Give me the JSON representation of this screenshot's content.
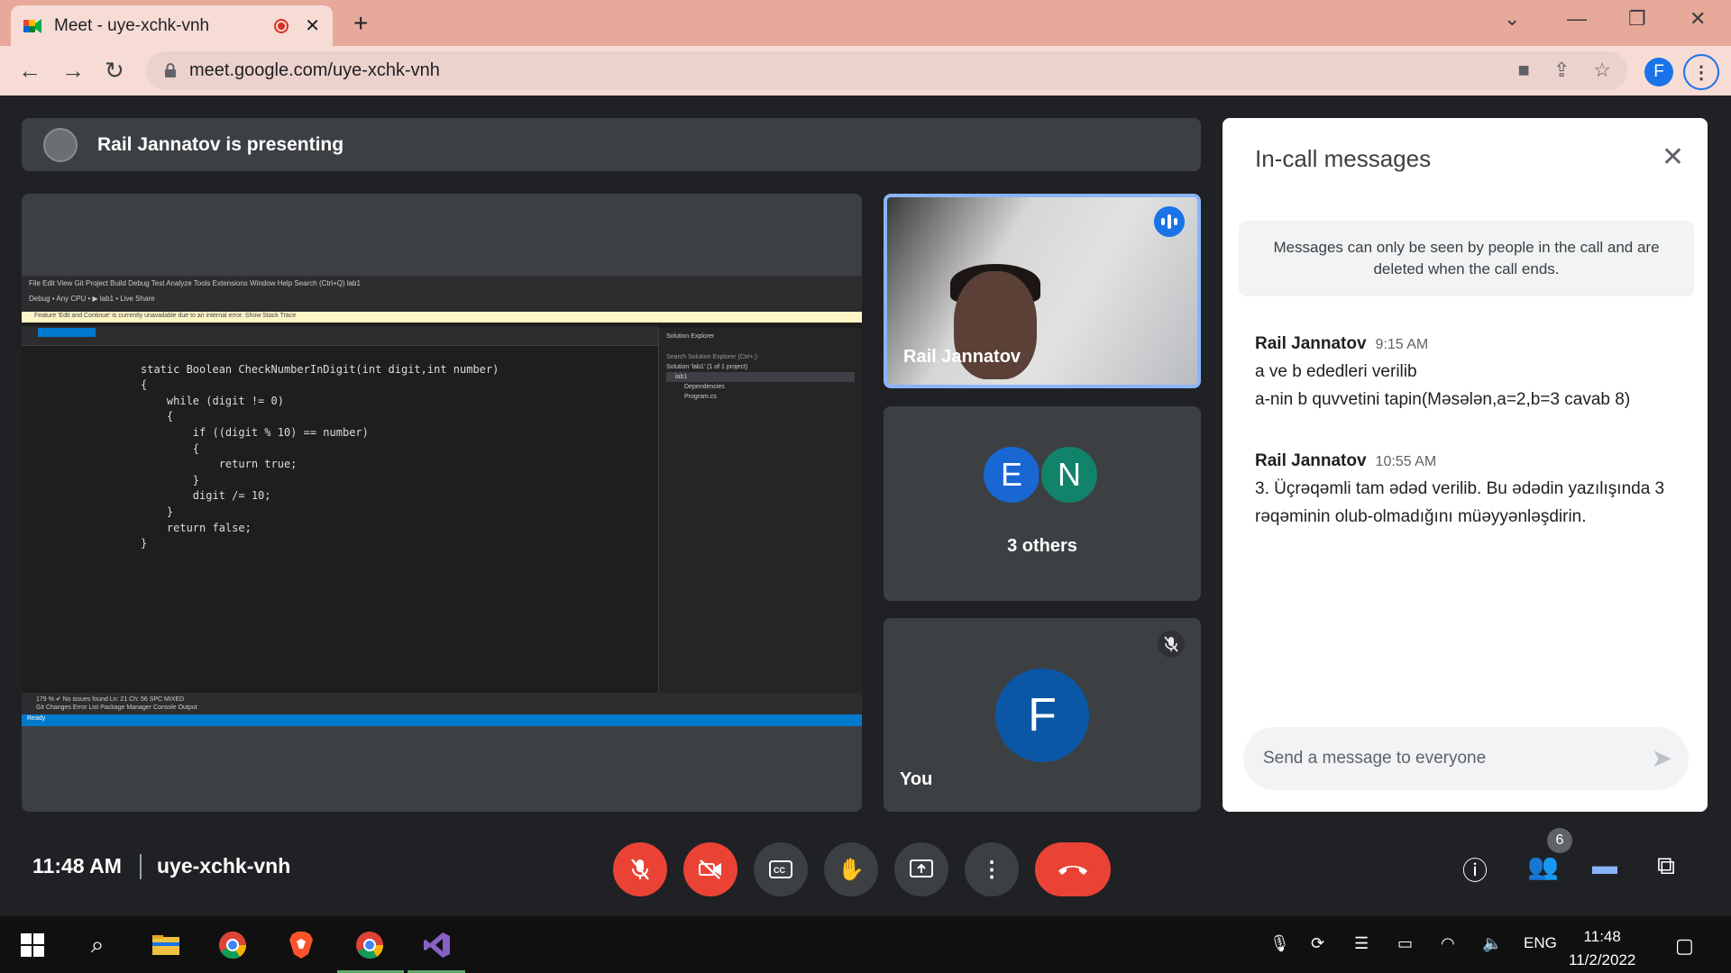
{
  "browser": {
    "tab_title": "Meet - uye-xchk-vnh",
    "url": "meet.google.com/uye-xchk-vnh",
    "profile_initial": "F"
  },
  "presenting": {
    "text": "Rail Jannatov is presenting"
  },
  "screen_share": {
    "vs_menu": "File  Edit  View  Git  Project  Build  Debug  Test  Analyze  Tools  Extensions  Window  Help   Search (Ctrl+Q)        lab1",
    "vs_toolbar": "Debug  •  Any CPU  •  ▶ lab1 •                                                                        Live Share",
    "vs_warning": "Feature 'Edit and Continue' is currently unavailable due to an internal error.   Show Stack Trace",
    "code": {
      "line1": "static Boolean CheckNumberInDigit(int digit,int number)",
      "line2": "{",
      "line3": "    while (digit != 0)",
      "line4": "    {",
      "line5": "        if ((digit % 10) == number)",
      "line6": "        {",
      "line7": "            return true;",
      "line8": "        }",
      "line9": "        digit /= 10;",
      "line10": "",
      "line11": "    }",
      "line12": "",
      "line13": "    return false;",
      "line14": "}"
    },
    "solution_explorer": {
      "title": "Solution Explorer",
      "search": "Search Solution Explorer (Ctrl+;)",
      "item1": "Solution 'lab1' (1 of 1 project)",
      "item2": "lab1",
      "item3": "Dependencies",
      "item4": "Program.cs"
    },
    "vs_bottom": "179 %   ✔ No issues found                                                                   Ln: 21   Ch: 56   SPC   MIXED",
    "vs_bottom_tabs": "Git Changes   Error List   Package Manager Console   Output",
    "vs_status": "Ready"
  },
  "tiles": {
    "main_name": "Rail Jannatov",
    "others_label": "3 others",
    "others_avatars": [
      "E",
      "N"
    ],
    "others_colors": [
      "#1967d2",
      "#12836b"
    ],
    "you_label": "You",
    "you_initial": "F"
  },
  "chat": {
    "title": "In-call messages",
    "note": "Messages can only be seen by people in the call and are deleted when the call ends.",
    "messages": [
      {
        "author": "Rail Jannatov",
        "time": "9:15 AM",
        "line1": "a ve b ededleri verilib",
        "line2": "a-nin b quvvetini tapin(Məsələn,a=2,b=3 cavab 8)"
      },
      {
        "author": "Rail Jannatov",
        "time": "10:55 AM",
        "line1": "3. Üçrəqəmli tam ədəd verilib. Bu ədədin yazılışında 3",
        "line2": "rəqəminin olub-olmadığını müəyyənləşdirin."
      }
    ],
    "input_placeholder": "Send a message to everyone"
  },
  "controls": {
    "time": "11:48 AM",
    "meeting_code": "uye-xchk-vnh",
    "participants_count": "6"
  },
  "taskbar": {
    "language": "ENG",
    "time": "11:48",
    "date": "11/2/2022"
  },
  "colors": {
    "meet_bg": "#202124",
    "tile_bg": "#3c4043",
    "mute_red": "#ea4335",
    "accent_blue": "#1a73e8",
    "chrome_tab_bg": "#e6a99a"
  },
  "icons": [
    "meet-logo-icon",
    "recording-icon",
    "close-icon",
    "plus-icon",
    "back-arrow-icon",
    "forward-arrow-icon",
    "reload-icon",
    "lock-icon",
    "camera-icon",
    "share-icon",
    "star-icon",
    "more-vert-icon",
    "mic-off-icon",
    "cam-off-icon",
    "captions-icon",
    "raise-hand-icon",
    "present-icon",
    "end-call-icon",
    "info-icon",
    "people-icon",
    "chat-icon",
    "activities-icon",
    "send-icon",
    "speaking-icon"
  ]
}
